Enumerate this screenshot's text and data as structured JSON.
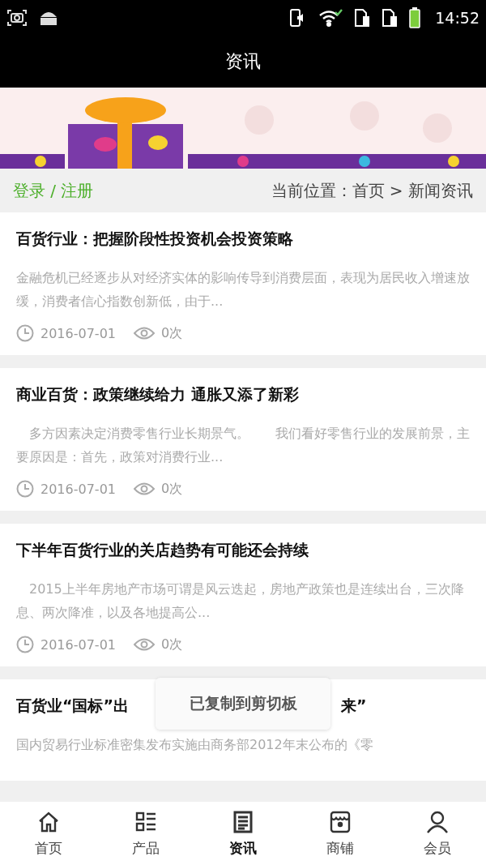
{
  "status_bar": {
    "time": "14:52"
  },
  "header": {
    "title": "资讯"
  },
  "location_bar": {
    "login": "登录 / 注册",
    "breadcrumb": "当前位置：首页 > 新闻资讯"
  },
  "articles": [
    {
      "title": "百货行业：把握阶段性投资机会投资策略",
      "summary": "金融危机已经逐步从对经济实体的影响传导到消费层面，表现为居民收入增速放缓，消费者信心指数创新低，由于...",
      "date": "2016-07-01",
      "views": "0次"
    },
    {
      "title": "商业百货：政策继续给力 通胀又添了新彩",
      "summary": "　多方因素决定消费零售行业长期景气。　　我们看好零售行业的发展前景，主要原因是：首先，政策对消费行业...",
      "date": "2016-07-01",
      "views": "0次"
    },
    {
      "title": "下半年百货行业的关店趋势有可能还会持续",
      "summary": "　2015上半年房地产市场可谓是风云迭起，房地产政策也是连续出台，三次降息、两次降准，以及各地提高公...",
      "date": "2016-07-01",
      "views": "0次"
    },
    {
      "title": "百货业“国标”出",
      "title_tail": "来”",
      "summary": "国内贸易行业标准密集发布实施由商务部2012年末公布的《零"
    }
  ],
  "toast": {
    "text": "已复制到剪切板"
  },
  "tab_bar": [
    {
      "label": "首页",
      "kind": "home",
      "selected": false
    },
    {
      "label": "产品",
      "kind": "list",
      "selected": false
    },
    {
      "label": "资讯",
      "kind": "news",
      "selected": true
    },
    {
      "label": "商铺",
      "kind": "shop",
      "selected": false
    },
    {
      "label": "会员",
      "kind": "user",
      "selected": false
    }
  ]
}
